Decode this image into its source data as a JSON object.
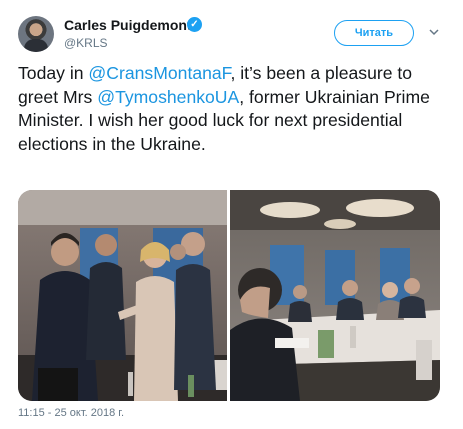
{
  "author": {
    "display_name": "Carles Puigdemont",
    "handle": "@KRLS",
    "verified_icon": "verified-badge-icon",
    "avatar_icon": "profile-photo"
  },
  "follow_button": {
    "label": "Читать"
  },
  "menu_icon": "chevron-down-icon",
  "tweet": {
    "text_1": "Today in ",
    "mention_1": "@CransMontanaF",
    "text_2": ", it’s been a pleasure to greet Mrs ",
    "mention_2": "@TymoshenkoUA",
    "text_3": ", former Ukrainian Prime Minister. I wish her good luck for next presidential elections in the Ukraine."
  },
  "media": [
    {
      "name": "photo-handshake"
    },
    {
      "name": "photo-conference-table"
    }
  ],
  "timestamp": "11:15 - 25 окт. 2018 г.",
  "colors": {
    "accent": "#1da1f2",
    "mention": "#1b95e0",
    "muted": "#657786",
    "text": "#14171a"
  }
}
